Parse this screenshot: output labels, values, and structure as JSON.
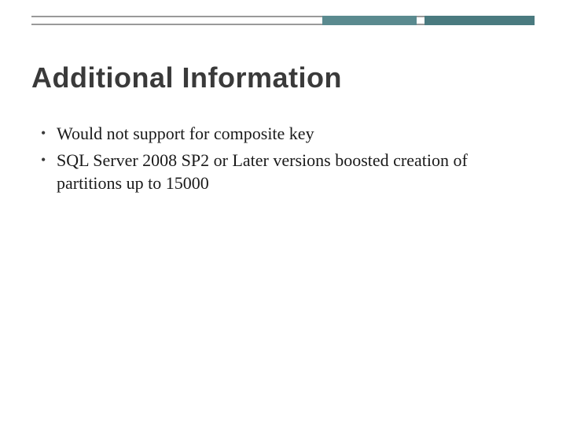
{
  "slide": {
    "title": "Additional Information",
    "bullets": [
      "Would not support for composite key",
      "SQL Server 2008 SP2 or Later versions boosted creation of partitions up to 15000"
    ]
  }
}
